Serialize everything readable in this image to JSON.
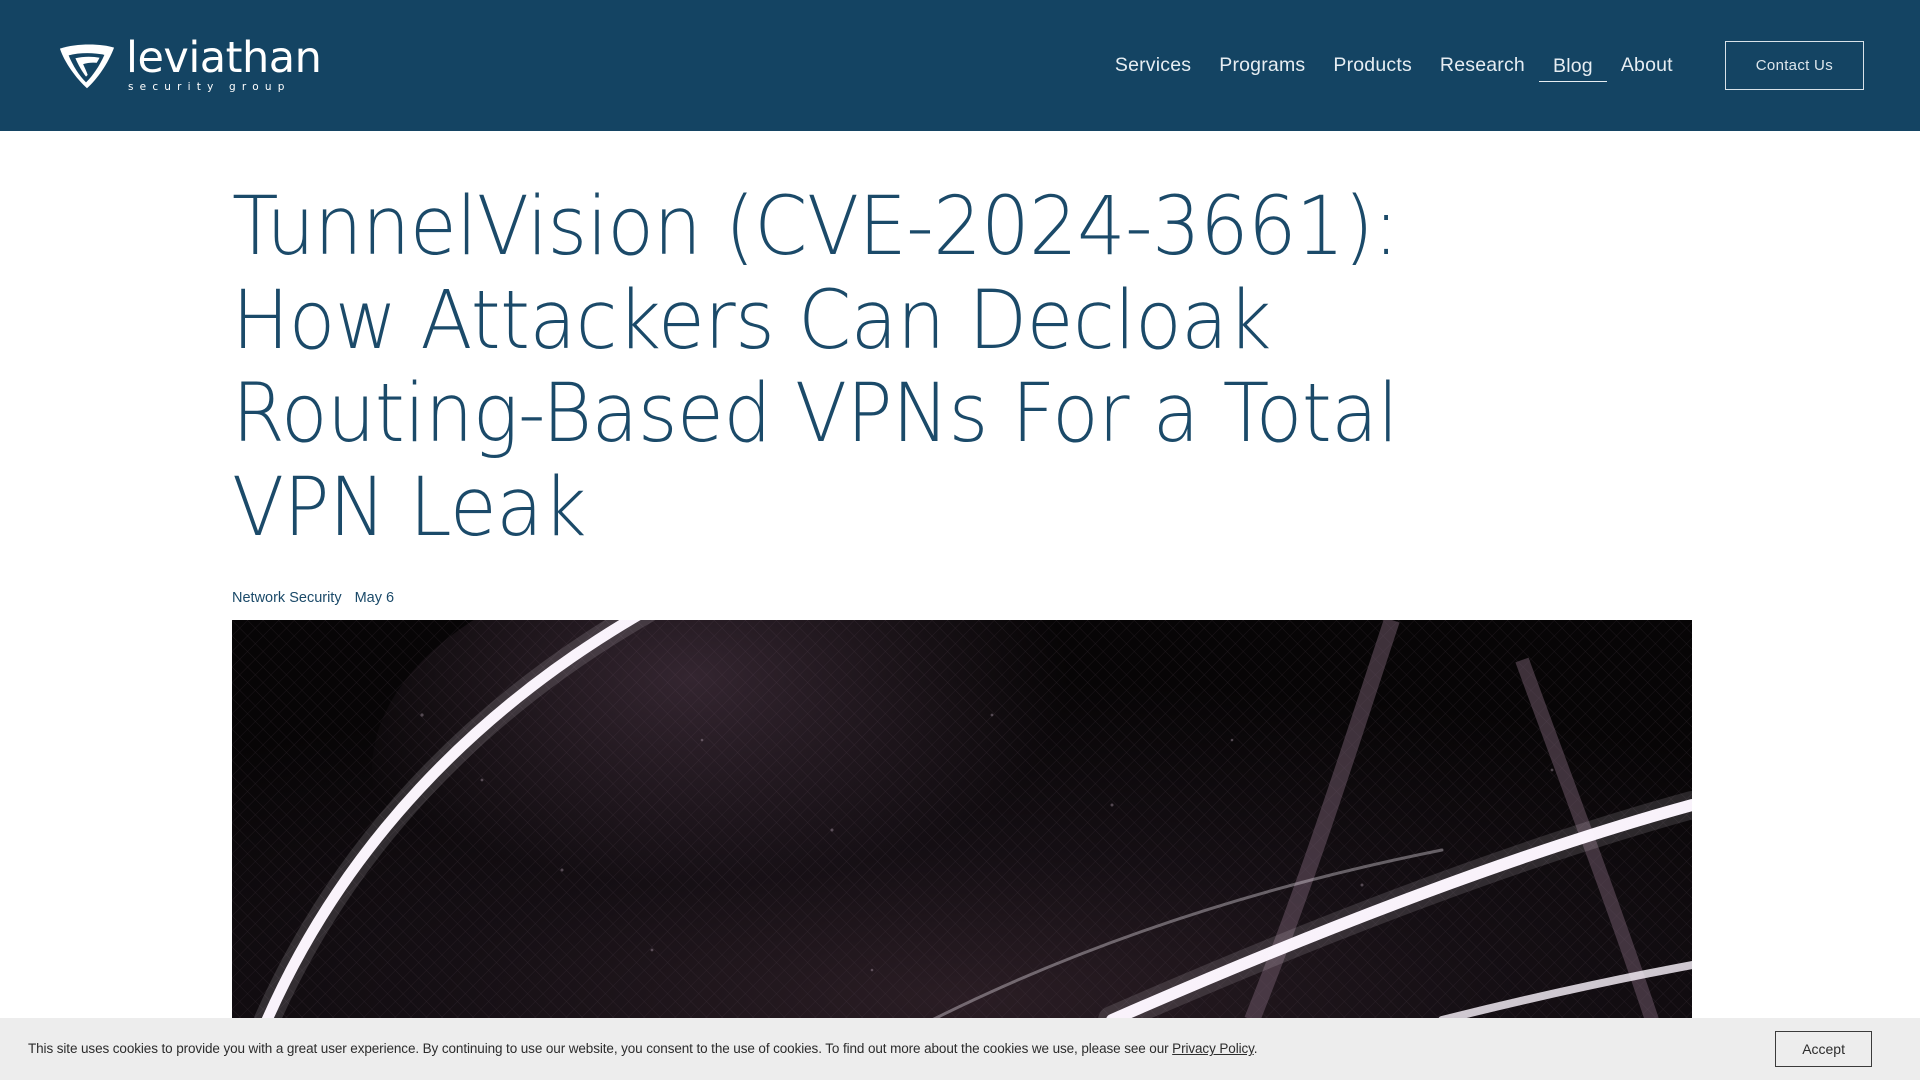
{
  "header": {
    "logo": {
      "wordmark": "leviathan",
      "tagline": "security group",
      "mark_icon": "shield-swoosh-icon"
    },
    "nav": [
      {
        "label": "Services",
        "active": false
      },
      {
        "label": "Programs",
        "active": false
      },
      {
        "label": "Products",
        "active": false
      },
      {
        "label": "Research",
        "active": false
      },
      {
        "label": "Blog",
        "active": true
      },
      {
        "label": "About",
        "active": false
      }
    ],
    "cta_label": "Contact Us",
    "background_color": "#144463",
    "text_color": "#e6edf2"
  },
  "article": {
    "title": "TunnelVision (CVE-2024-3661): How Attackers Can Decloak Routing-Based VPNs For a Total VPN Leak",
    "category": "Network Security",
    "date": "May 6",
    "title_color": "#1b4a69",
    "hero_alt": "dark tunnel with bright curved light arcs"
  },
  "cookie_banner": {
    "text_before": "This site uses cookies to provide you with a great user experience. By continuing to use our website, you consent to the use of cookies. To find out more about the cookies we use, please see our ",
    "link_label": "Privacy Policy",
    "text_after": ".",
    "accept_label": "Accept",
    "background_color": "#ededed"
  }
}
